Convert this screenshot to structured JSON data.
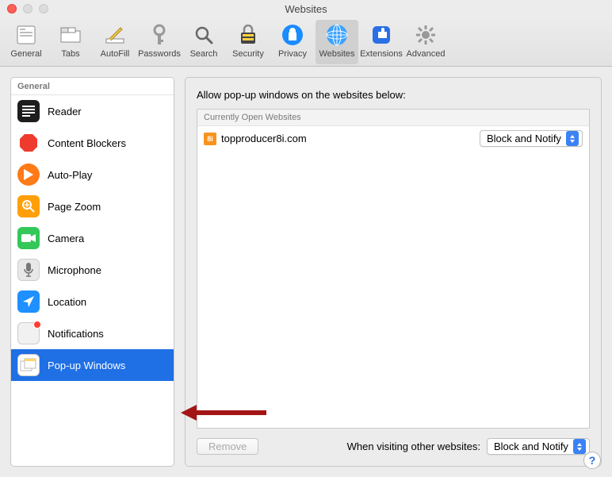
{
  "window_title": "Websites",
  "toolbar": [
    {
      "id": "general",
      "label": "General"
    },
    {
      "id": "tabs",
      "label": "Tabs"
    },
    {
      "id": "autofill",
      "label": "AutoFill"
    },
    {
      "id": "passwords",
      "label": "Passwords"
    },
    {
      "id": "search",
      "label": "Search"
    },
    {
      "id": "security",
      "label": "Security"
    },
    {
      "id": "privacy",
      "label": "Privacy"
    },
    {
      "id": "websites",
      "label": "Websites",
      "selected": true
    },
    {
      "id": "extensions",
      "label": "Extensions"
    },
    {
      "id": "advanced",
      "label": "Advanced"
    }
  ],
  "sidebar": {
    "header": "General",
    "items": [
      {
        "id": "reader",
        "label": "Reader"
      },
      {
        "id": "content-blockers",
        "label": "Content Blockers"
      },
      {
        "id": "auto-play",
        "label": "Auto-Play"
      },
      {
        "id": "page-zoom",
        "label": "Page Zoom"
      },
      {
        "id": "camera",
        "label": "Camera"
      },
      {
        "id": "microphone",
        "label": "Microphone"
      },
      {
        "id": "location",
        "label": "Location"
      },
      {
        "id": "notifications",
        "label": "Notifications"
      },
      {
        "id": "popup",
        "label": "Pop-up Windows",
        "selected": true
      }
    ]
  },
  "main": {
    "heading": "Allow pop-up windows on the websites below:",
    "list_header": "Currently Open Websites",
    "rows": [
      {
        "favicon_text": "8i",
        "domain": "topproducer8i.com",
        "action": "Block and Notify"
      }
    ],
    "remove_label": "Remove",
    "footer_label": "When visiting other websites:",
    "footer_action": "Block and Notify"
  },
  "help_label": "?"
}
